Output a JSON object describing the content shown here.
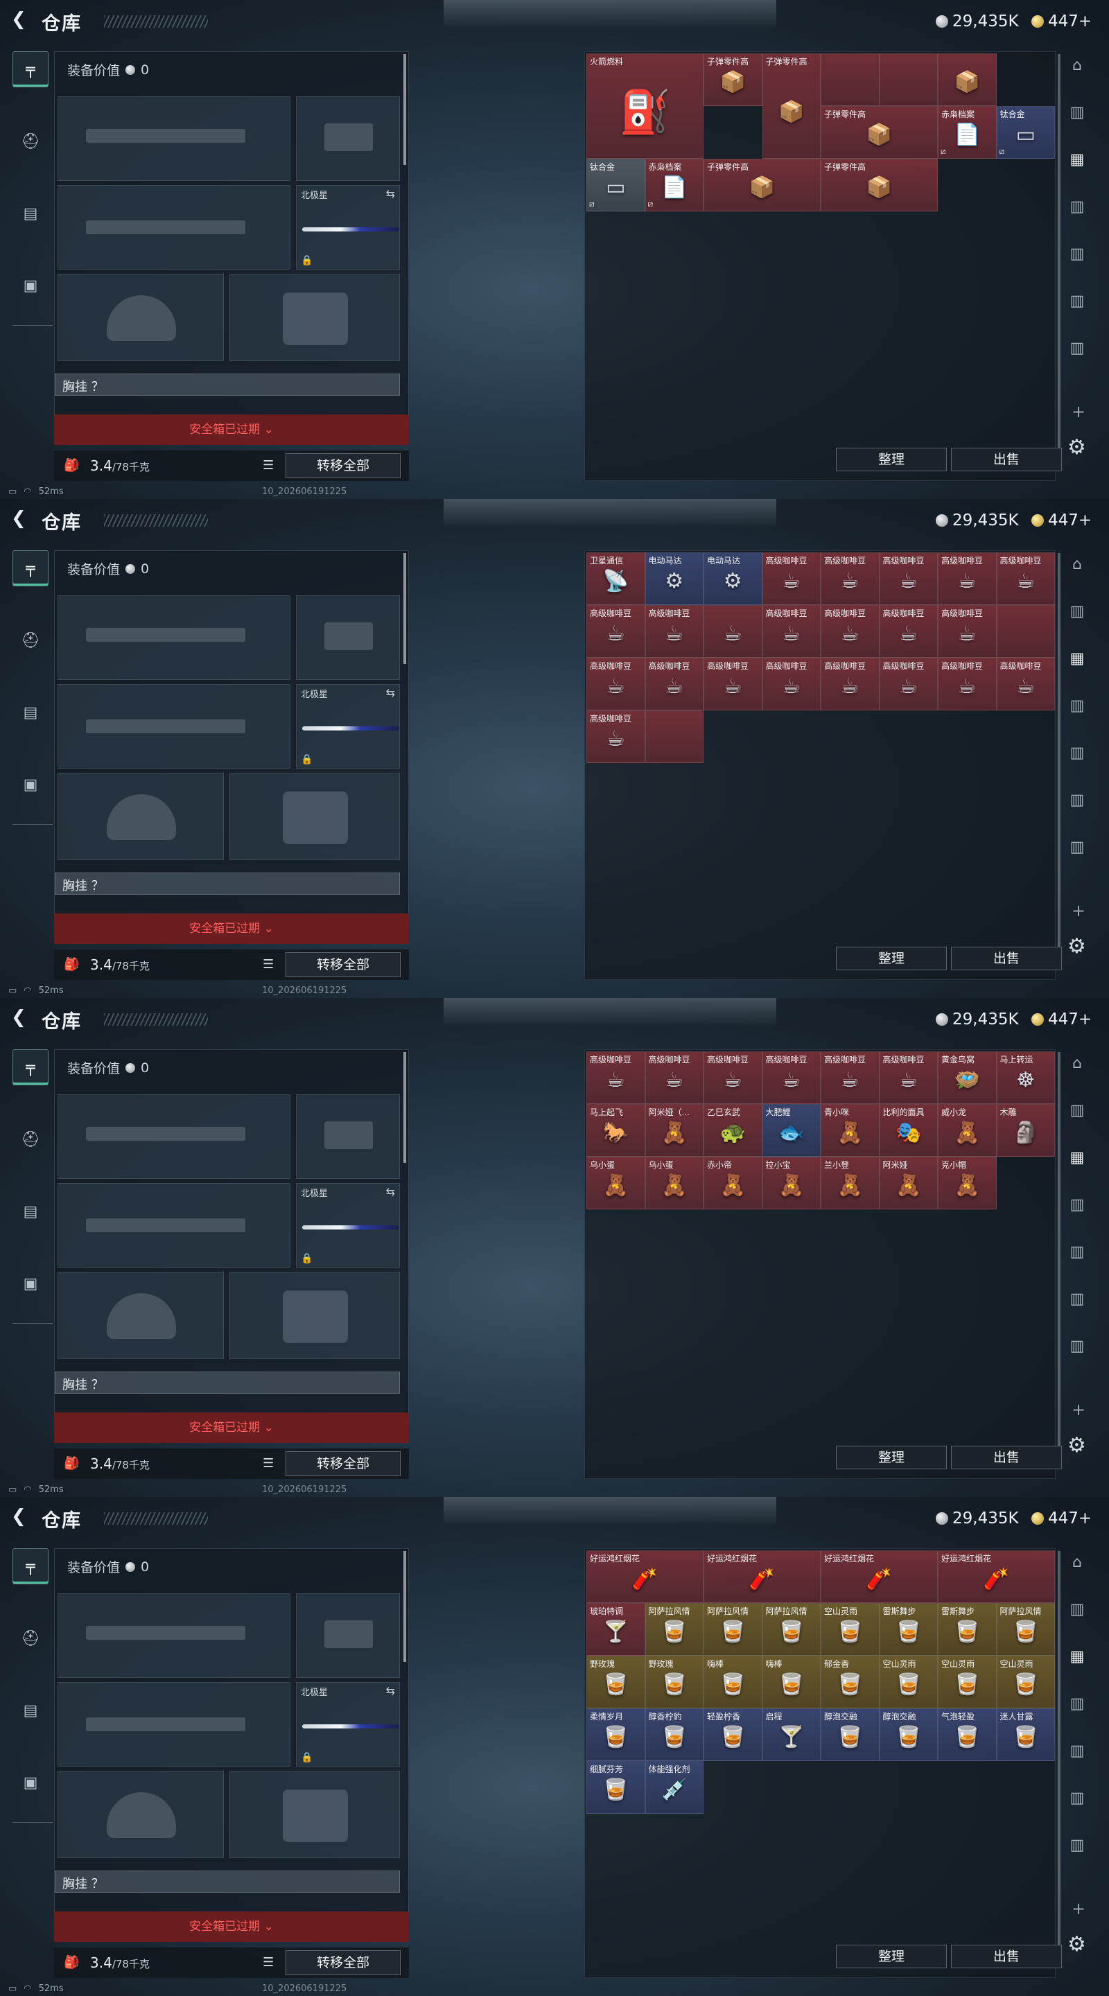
{
  "app": {
    "title": "仓库",
    "back_icon": "chevron-left-icon",
    "currency_silver": "29,435K",
    "currency_gold": "447+"
  },
  "loadout": {
    "equip_value_label": "装备价值",
    "equip_value": "0",
    "melee_slot_label": "北极星",
    "chest_rig_label": "胸挂 ？",
    "safe_box_expired": "安全箱已过期",
    "weight_value": "3.4",
    "weight_unit": "/78千克",
    "transfer_all": "转移全部"
  },
  "status": {
    "ping": "52ms",
    "build_id": "10_202606191225"
  },
  "buttons": {
    "sort": "整理",
    "sell": "出售"
  },
  "colors": {
    "accent_green": "#4fbfa0",
    "expired_red": "#6b1d1f",
    "rarity_red": "#763038",
    "rarity_blue": "#3a4670",
    "rarity_gray": "#525a64",
    "rarity_gold": "#6e5c2c"
  },
  "screens": [
    {
      "items": [
        {
          "name": "火箭燃料",
          "rarity": "red",
          "icon": "fuel-can-icon",
          "w": 2,
          "h": 2,
          "big": true
        },
        {
          "name": "子弹零件高",
          "rarity": "red",
          "icon": "ammo-parts-icon",
          "w": 1,
          "h": 1
        },
        {
          "name": "子弹零件高",
          "rarity": "red",
          "icon": "ammo-parts-icon",
          "w": 1,
          "h": 2
        },
        {
          "name": "",
          "rarity": "red",
          "icon": "",
          "w": 1,
          "h": 1
        },
        {
          "name": "",
          "rarity": "red",
          "icon": "",
          "w": 1,
          "h": 1
        },
        {
          "name": "",
          "rarity": "red",
          "icon": "ammo-parts-icon",
          "w": 1,
          "h": 1
        },
        {
          "name": "子弹零件高",
          "rarity": "red",
          "icon": "ammo-parts-icon",
          "w": 2,
          "h": 1
        },
        {
          "name": "赤枭档案",
          "rarity": "red",
          "icon": "document-icon",
          "w": 1,
          "h": 1,
          "mark": "⧄"
        },
        {
          "name": "钛合金",
          "rarity": "blue",
          "icon": "metal-ingot-icon",
          "w": 1,
          "h": 1,
          "mark": "⧄"
        },
        {
          "name": "钛合金",
          "rarity": "gray",
          "icon": "metal-ingot-icon",
          "w": 1,
          "h": 1,
          "mark": "⧄"
        },
        {
          "name": "赤枭档案",
          "rarity": "red",
          "icon": "document-icon",
          "w": 1,
          "h": 1,
          "mark": "⧄"
        },
        {
          "name": "子弹零件高",
          "rarity": "red",
          "icon": "ammo-parts-icon",
          "w": 2,
          "h": 1
        },
        {
          "name": "子弹零件高",
          "rarity": "red",
          "icon": "ammo-parts-icon",
          "w": 2,
          "h": 1
        }
      ]
    },
    {
      "items": [
        {
          "name": "卫星通信",
          "rarity": "red",
          "icon": "satellite-dish-icon",
          "w": 1,
          "h": 1
        },
        {
          "name": "电动马达",
          "rarity": "blue",
          "icon": "motor-icon",
          "w": 1,
          "h": 1
        },
        {
          "name": "电动马达",
          "rarity": "blue",
          "icon": "motor-icon",
          "w": 1,
          "h": 1
        },
        {
          "name": "高级咖啡豆",
          "rarity": "red",
          "icon": "coffee-bag-icon",
          "w": 1,
          "h": 1
        },
        {
          "name": "高级咖啡豆",
          "rarity": "red",
          "icon": "coffee-bag-icon",
          "w": 1,
          "h": 1
        },
        {
          "name": "高级咖啡豆",
          "rarity": "red",
          "icon": "coffee-bag-icon",
          "w": 1,
          "h": 1
        },
        {
          "name": "高级咖啡豆",
          "rarity": "red",
          "icon": "coffee-box-icon",
          "w": 1,
          "h": 1
        },
        {
          "name": "高级咖啡豆",
          "rarity": "red",
          "icon": "coffee-box-icon",
          "w": 1,
          "h": 1
        },
        {
          "name": "高级咖啡豆",
          "rarity": "red",
          "icon": "coffee-box-icon",
          "w": 1,
          "h": 1
        },
        {
          "name": "高级咖啡豆",
          "rarity": "red",
          "icon": "coffee-box-icon",
          "w": 1,
          "h": 1
        },
        {
          "name": "",
          "rarity": "red",
          "icon": "coffee-bag-icon",
          "w": 1,
          "h": 1
        },
        {
          "name": "高级咖啡豆",
          "rarity": "red",
          "icon": "coffee-box-icon",
          "w": 1,
          "h": 1
        },
        {
          "name": "高级咖啡豆",
          "rarity": "red",
          "icon": "coffee-box-icon",
          "w": 1,
          "h": 1
        },
        {
          "name": "高级咖啡豆",
          "rarity": "red",
          "icon": "coffee-box-icon",
          "w": 1,
          "h": 1
        },
        {
          "name": "高级咖啡豆",
          "rarity": "red",
          "icon": "coffee-box-icon",
          "w": 1,
          "h": 1
        },
        {
          "name": "",
          "rarity": "red",
          "icon": "",
          "w": 1,
          "h": 1
        },
        {
          "name": "高级咖啡豆",
          "rarity": "red",
          "icon": "coffee-box-icon",
          "w": 1,
          "h": 1
        },
        {
          "name": "高级咖啡豆",
          "rarity": "red",
          "icon": "coffee-box-icon",
          "w": 1,
          "h": 1
        },
        {
          "name": "高级咖啡豆",
          "rarity": "red",
          "icon": "coffee-box-icon",
          "w": 1,
          "h": 1
        },
        {
          "name": "高级咖啡豆",
          "rarity": "red",
          "icon": "coffee-box-icon",
          "w": 1,
          "h": 1
        },
        {
          "name": "高级咖啡豆",
          "rarity": "red",
          "icon": "coffee-bag-icon",
          "w": 1,
          "h": 1
        },
        {
          "name": "高级咖啡豆",
          "rarity": "red",
          "icon": "coffee-box-icon",
          "w": 1,
          "h": 1
        },
        {
          "name": "高级咖啡豆",
          "rarity": "red",
          "icon": "coffee-box-icon",
          "w": 1,
          "h": 1
        },
        {
          "name": "高级咖啡豆",
          "rarity": "red",
          "icon": "coffee-box-icon",
          "w": 1,
          "h": 1
        },
        {
          "name": "高级咖啡豆",
          "rarity": "red",
          "icon": "coffee-box-icon",
          "w": 1,
          "h": 1
        },
        {
          "name": "",
          "rarity": "red",
          "icon": "",
          "w": 1,
          "h": 1
        }
      ]
    },
    {
      "items": [
        {
          "name": "高级咖啡豆",
          "rarity": "red",
          "icon": "coffee-box-icon",
          "w": 1,
          "h": 1
        },
        {
          "name": "高级咖啡豆",
          "rarity": "red",
          "icon": "coffee-box-icon",
          "w": 1,
          "h": 1
        },
        {
          "name": "高级咖啡豆",
          "rarity": "red",
          "icon": "coffee-box-icon",
          "w": 1,
          "h": 1
        },
        {
          "name": "高级咖啡豆",
          "rarity": "red",
          "icon": "coffee-box-icon",
          "w": 1,
          "h": 1
        },
        {
          "name": "高级咖啡豆",
          "rarity": "red",
          "icon": "coffee-bag-icon",
          "w": 1,
          "h": 1
        },
        {
          "name": "高级咖啡豆",
          "rarity": "red",
          "icon": "coffee-box-icon",
          "w": 1,
          "h": 1
        },
        {
          "name": "黄金鸟窝",
          "rarity": "red",
          "icon": "golden-nest-icon",
          "w": 1,
          "h": 1
        },
        {
          "name": "马上转运",
          "rarity": "red",
          "icon": "golden-wheel-icon",
          "w": 1,
          "h": 1
        },
        {
          "name": "马上起飞",
          "rarity": "red",
          "icon": "horse-statue-icon",
          "w": 1,
          "h": 1
        },
        {
          "name": "阿米娅（...",
          "rarity": "red",
          "icon": "figure-icon",
          "w": 1,
          "h": 1
        },
        {
          "name": "乙巳玄武",
          "rarity": "red",
          "icon": "golden-turtle-icon",
          "w": 1,
          "h": 1
        },
        {
          "name": "大肥鲤",
          "rarity": "blue",
          "icon": "fish-icon",
          "w": 1,
          "h": 1
        },
        {
          "name": "青小咪",
          "rarity": "red",
          "icon": "figure-icon",
          "w": 1,
          "h": 1
        },
        {
          "name": "比利的面具",
          "rarity": "red",
          "icon": "mask-icon",
          "w": 1,
          "h": 1
        },
        {
          "name": "威小龙",
          "rarity": "red",
          "icon": "figure-icon",
          "w": 1,
          "h": 1
        },
        {
          "name": "木雕",
          "rarity": "red",
          "icon": "wood-carving-icon",
          "w": 1,
          "h": 1
        },
        {
          "name": "乌小蛋",
          "rarity": "red",
          "icon": "figure-icon",
          "w": 1,
          "h": 1
        },
        {
          "name": "乌小蛋",
          "rarity": "red",
          "icon": "figure-icon",
          "w": 1,
          "h": 1
        },
        {
          "name": "赤小帝",
          "rarity": "red",
          "icon": "figure-icon",
          "w": 1,
          "h": 1
        },
        {
          "name": "拉小宝",
          "rarity": "red",
          "icon": "figure-icon",
          "w": 1,
          "h": 1
        },
        {
          "name": "兰小登",
          "rarity": "red",
          "icon": "figure-icon",
          "w": 1,
          "h": 1
        },
        {
          "name": "阿米娅",
          "rarity": "red",
          "icon": "figure-icon",
          "w": 1,
          "h": 1
        },
        {
          "name": "克小帽",
          "rarity": "red",
          "icon": "figure-icon",
          "w": 1,
          "h": 1
        }
      ]
    },
    {
      "items": [
        {
          "name": "好运鸿红烟花",
          "rarity": "red",
          "icon": "firecracker-icon",
          "w": 2,
          "h": 1
        },
        {
          "name": "好运鸿红烟花",
          "rarity": "red",
          "icon": "firecracker-icon",
          "w": 2,
          "h": 1
        },
        {
          "name": "好运鸿红烟花",
          "rarity": "red",
          "icon": "firecracker-icon",
          "w": 2,
          "h": 1
        },
        {
          "name": "好运鸿红烟花",
          "rarity": "red",
          "icon": "firecracker-icon",
          "w": 2,
          "h": 1
        },
        {
          "name": "琥珀特调",
          "rarity": "red",
          "icon": "cocktail-icon",
          "w": 1,
          "h": 1
        },
        {
          "name": "阿萨拉风情",
          "rarity": "gold",
          "icon": "drink-icon",
          "w": 1,
          "h": 1
        },
        {
          "name": "阿萨拉风情",
          "rarity": "gold",
          "icon": "drink-icon",
          "w": 1,
          "h": 1
        },
        {
          "name": "阿萨拉风情",
          "rarity": "gold",
          "icon": "drink-icon",
          "w": 1,
          "h": 1
        },
        {
          "name": "空山灵雨",
          "rarity": "gold",
          "icon": "drink-icon",
          "w": 1,
          "h": 1
        },
        {
          "name": "雷斯舞步",
          "rarity": "gold",
          "icon": "drink-icon",
          "w": 1,
          "h": 1
        },
        {
          "name": "雷斯舞步",
          "rarity": "gold",
          "icon": "drink-icon",
          "w": 1,
          "h": 1
        },
        {
          "name": "阿萨拉风情",
          "rarity": "gold",
          "icon": "drink-icon",
          "w": 1,
          "h": 1
        },
        {
          "name": "野玫瑰",
          "rarity": "gold",
          "icon": "drink-icon",
          "w": 1,
          "h": 1
        },
        {
          "name": "野玫瑰",
          "rarity": "gold",
          "icon": "drink-icon",
          "w": 1,
          "h": 1
        },
        {
          "name": "嗨棒",
          "rarity": "gold",
          "icon": "drink-icon",
          "w": 1,
          "h": 1
        },
        {
          "name": "嗨棒",
          "rarity": "gold",
          "icon": "drink-icon",
          "w": 1,
          "h": 1
        },
        {
          "name": "郁金香",
          "rarity": "gold",
          "icon": "drink-icon",
          "w": 1,
          "h": 1
        },
        {
          "name": "空山灵雨",
          "rarity": "gold",
          "icon": "drink-icon",
          "w": 1,
          "h": 1
        },
        {
          "name": "空山灵雨",
          "rarity": "gold",
          "icon": "drink-icon",
          "w": 1,
          "h": 1
        },
        {
          "name": "空山灵雨",
          "rarity": "gold",
          "icon": "drink-icon",
          "w": 1,
          "h": 1
        },
        {
          "name": "柔情岁月",
          "rarity": "blue",
          "icon": "drink-icon",
          "w": 1,
          "h": 1
        },
        {
          "name": "醇香柠豹",
          "rarity": "blue",
          "icon": "drink-icon",
          "w": 1,
          "h": 1
        },
        {
          "name": "轻盈柠香",
          "rarity": "blue",
          "icon": "drink-icon",
          "w": 1,
          "h": 1
        },
        {
          "name": "启程",
          "rarity": "blue",
          "icon": "cocktail-icon",
          "w": 1,
          "h": 1
        },
        {
          "name": "醇泡交融",
          "rarity": "blue",
          "icon": "drink-icon",
          "w": 1,
          "h": 1
        },
        {
          "name": "醇泡交融",
          "rarity": "blue",
          "icon": "drink-icon",
          "w": 1,
          "h": 1
        },
        {
          "name": "气泡轻盈",
          "rarity": "blue",
          "icon": "drink-icon",
          "w": 1,
          "h": 1
        },
        {
          "name": "迷人甘露",
          "rarity": "blue",
          "icon": "drink-icon",
          "w": 1,
          "h": 1
        },
        {
          "name": "细腻芬芳",
          "rarity": "blue",
          "icon": "drink-icon",
          "w": 1,
          "h": 1
        },
        {
          "name": "体能强化剂",
          "rarity": "blue",
          "icon": "syringe-icon",
          "w": 1,
          "h": 1
        }
      ]
    }
  ]
}
